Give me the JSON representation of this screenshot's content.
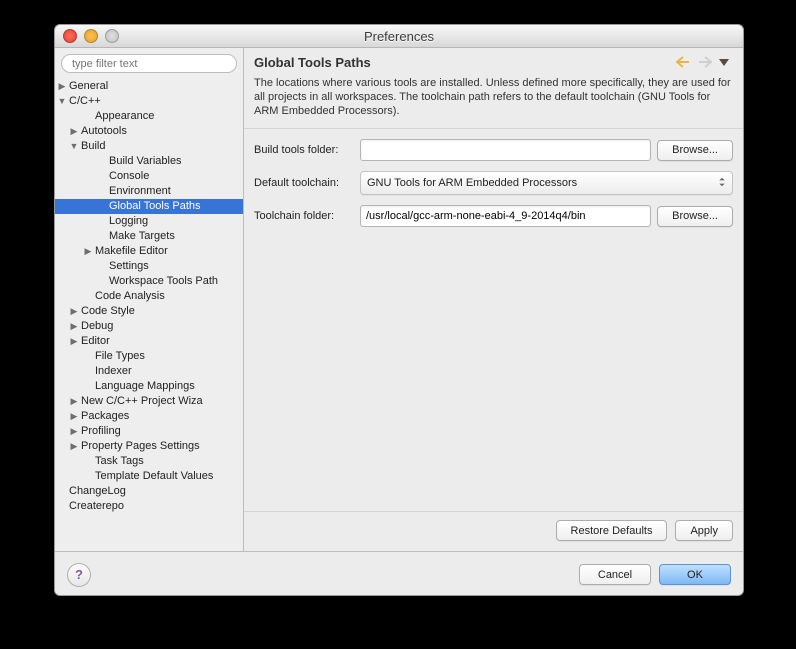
{
  "window": {
    "title": "Preferences"
  },
  "filter": {
    "placeholder": "type filter text"
  },
  "tree": {
    "general": "General",
    "ccpp": "C/C++",
    "appearance": "Appearance",
    "autotools": "Autotools",
    "build": "Build",
    "build_vars": "Build Variables",
    "console": "Console",
    "environment": "Environment",
    "global_tools_paths": "Global Tools Paths",
    "logging": "Logging",
    "make_targets": "Make Targets",
    "makefile_editor": "Makefile Editor",
    "settings": "Settings",
    "workspace_tools_path": "Workspace Tools Path",
    "code_analysis": "Code Analysis",
    "code_style": "Code Style",
    "debug": "Debug",
    "editor": "Editor",
    "file_types": "File Types",
    "indexer": "Indexer",
    "language_mappings": "Language Mappings",
    "new_project_wiz": "New C/C++ Project Wiza",
    "packages": "Packages",
    "profiling": "Profiling",
    "property_pages": "Property Pages Settings",
    "task_tags": "Task Tags",
    "template_defaults": "Template Default Values",
    "changelog": "ChangeLog",
    "createrepo": "Createrepo"
  },
  "page": {
    "title": "Global Tools Paths",
    "description": "The locations where various tools are installed. Unless defined more specifically, they are used for all projects in all workspaces. The toolchain path refers to the default toolchain (GNU Tools for ARM Embedded Processors).",
    "build_tools_label": "Build tools folder:",
    "build_tools_value": "",
    "default_toolchain_label": "Default toolchain:",
    "default_toolchain_value": "GNU Tools for ARM Embedded Processors",
    "toolchain_folder_label": "Toolchain folder:",
    "toolchain_folder_value": "/usr/local/gcc-arm-none-eabi-4_9-2014q4/bin",
    "browse": "Browse...",
    "restore_defaults": "Restore Defaults",
    "apply": "Apply"
  },
  "footer": {
    "cancel": "Cancel",
    "ok": "OK"
  }
}
